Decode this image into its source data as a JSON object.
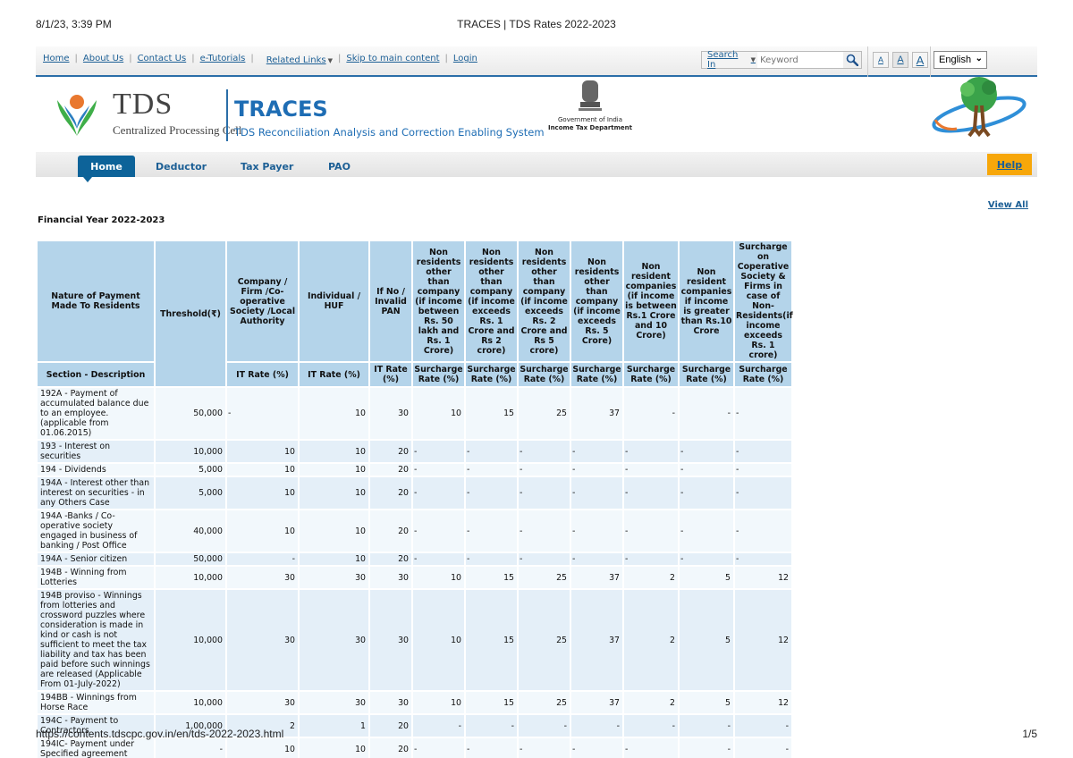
{
  "print": {
    "date": "8/1/23, 3:39 PM",
    "title": "TRACES | TDS Rates 2022-2023",
    "url": "https://contents.tdscpc.gov.in/en/tds-2022-2023.html",
    "page": "1/5"
  },
  "topbar": {
    "links": [
      "Home",
      "About Us",
      "Contact Us",
      "e-Tutorials"
    ],
    "related_links": "Related Links",
    "skip": "Skip to main content",
    "login": "Login",
    "search_in": "Search In",
    "search_placeholder": "Keyword",
    "font_sizes": [
      "A",
      "A",
      "A"
    ],
    "language": "English"
  },
  "banner": {
    "tds": "TDS",
    "cpc": "Centralized Processing Cell",
    "traces": "TRACES",
    "traces_sub": "TDS Reconciliation Analysis and Correction Enabling System",
    "gov": "Government of India",
    "itd": "Income Tax Department"
  },
  "nav": {
    "tabs": [
      "Home",
      "Deductor",
      "Tax Payer",
      "PAO"
    ],
    "active": "Home",
    "help": "Help"
  },
  "view_all": "View All",
  "fy_title": "Financial Year 2022-2023",
  "table": {
    "headers_top": [
      "Nature of Payment Made To Residents",
      "Threshold(₹)",
      "Company / Firm /Co-operative Society /Local Authority",
      "Individual / HUF",
      "If No / Invalid PAN",
      "Non residents other than company (if income between Rs. 50 lakh and Rs. 1 Crore)",
      "Non residents other than company (if income exceeds Rs. 1 Crore and Rs 2 crore)",
      "Non residents other than company (if income exceeds Rs. 2 Crore and Rs 5 crore)",
      "Non residents other than company (if income exceeds Rs. 5 Crore)",
      "Non resident companies (if income is between Rs.1 Crore and 10 Crore)",
      "Non resident companies if income is greater than Rs.10 Crore",
      "Surcharge on Coperative Society & Firms in case of Non-Residents(if income exceeds Rs. 1 crore)"
    ],
    "headers_sub": [
      "Section - Description",
      "IT Rate (%)",
      "IT Rate (%)",
      "IT Rate (%)",
      "Surcharge Rate (%)",
      "Surcharge Rate (%)",
      "Surcharge Rate (%)",
      "Surcharge Rate (%)",
      "Surcharge Rate (%)",
      "Surcharge Rate (%)",
      "Surcharge Rate (%)"
    ],
    "rows": [
      {
        "desc": "192A - Payment of accumulated balance due to an employee.(applicable from 01.06.2015)",
        "threshold": "50,000",
        "cells": [
          {
            "v": "-",
            "a": "l"
          },
          {
            "v": "10",
            "a": "r"
          },
          {
            "v": "30",
            "a": "r"
          },
          {
            "v": "10",
            "a": "r"
          },
          {
            "v": "15",
            "a": "r"
          },
          {
            "v": "25",
            "a": "r"
          },
          {
            "v": "37",
            "a": "r"
          },
          {
            "v": "-",
            "a": "r"
          },
          {
            "v": "-",
            "a": "r"
          },
          {
            "v": "-",
            "a": "l"
          }
        ]
      },
      {
        "desc": "193 - Interest on securities",
        "threshold": "10,000",
        "cells": [
          {
            "v": "10",
            "a": "r"
          },
          {
            "v": "10",
            "a": "r"
          },
          {
            "v": "20",
            "a": "r"
          },
          {
            "v": "-",
            "a": "l"
          },
          {
            "v": "-",
            "a": "l"
          },
          {
            "v": "-",
            "a": "l"
          },
          {
            "v": "-",
            "a": "l"
          },
          {
            "v": "-",
            "a": "l"
          },
          {
            "v": "-",
            "a": "l"
          },
          {
            "v": "-",
            "a": "l"
          }
        ]
      },
      {
        "desc": "194 - Dividends",
        "threshold": "5,000",
        "cells": [
          {
            "v": "10",
            "a": "r"
          },
          {
            "v": "10",
            "a": "r"
          },
          {
            "v": "20",
            "a": "r"
          },
          {
            "v": "-",
            "a": "l"
          },
          {
            "v": "-",
            "a": "l"
          },
          {
            "v": "-",
            "a": "l"
          },
          {
            "v": "-",
            "a": "l"
          },
          {
            "v": "-",
            "a": "l"
          },
          {
            "v": "-",
            "a": "l"
          },
          {
            "v": "-",
            "a": "l"
          }
        ]
      },
      {
        "desc": "194A - Interest other than interest on securities - in any Others Case",
        "threshold": "5,000",
        "cells": [
          {
            "v": "10",
            "a": "r"
          },
          {
            "v": "10",
            "a": "r"
          },
          {
            "v": "20",
            "a": "r"
          },
          {
            "v": "-",
            "a": "l"
          },
          {
            "v": "-",
            "a": "l"
          },
          {
            "v": "-",
            "a": "l"
          },
          {
            "v": "-",
            "a": "l"
          },
          {
            "v": "-",
            "a": "l"
          },
          {
            "v": "-",
            "a": "l"
          },
          {
            "v": "-",
            "a": "l"
          }
        ]
      },
      {
        "desc": "194A -Banks / Co-operative society engaged in business of banking / Post Office",
        "threshold": "40,000",
        "cells": [
          {
            "v": "10",
            "a": "r"
          },
          {
            "v": "10",
            "a": "r"
          },
          {
            "v": "20",
            "a": "r"
          },
          {
            "v": "-",
            "a": "l"
          },
          {
            "v": "-",
            "a": "l"
          },
          {
            "v": "-",
            "a": "l"
          },
          {
            "v": "-",
            "a": "l"
          },
          {
            "v": "-",
            "a": "l"
          },
          {
            "v": "-",
            "a": "l"
          },
          {
            "v": "-",
            "a": "l"
          }
        ]
      },
      {
        "desc": "194A - Senior citizen",
        "threshold": "50,000",
        "cells": [
          {
            "v": "-",
            "a": "r"
          },
          {
            "v": "10",
            "a": "r"
          },
          {
            "v": "20",
            "a": "r"
          },
          {
            "v": "-",
            "a": "l"
          },
          {
            "v": "-",
            "a": "l"
          },
          {
            "v": "-",
            "a": "l"
          },
          {
            "v": "-",
            "a": "l"
          },
          {
            "v": "-",
            "a": "l"
          },
          {
            "v": "-",
            "a": "l"
          },
          {
            "v": "-",
            "a": "l"
          }
        ]
      },
      {
        "desc": "194B - Winning from Lotteries",
        "threshold": "10,000",
        "cells": [
          {
            "v": "30",
            "a": "r"
          },
          {
            "v": "30",
            "a": "r"
          },
          {
            "v": "30",
            "a": "r"
          },
          {
            "v": "10",
            "a": "r"
          },
          {
            "v": "15",
            "a": "r"
          },
          {
            "v": "25",
            "a": "r"
          },
          {
            "v": "37",
            "a": "r"
          },
          {
            "v": "2",
            "a": "r"
          },
          {
            "v": "5",
            "a": "r"
          },
          {
            "v": "12",
            "a": "r"
          }
        ]
      },
      {
        "desc": "194B proviso - Winnings from lotteries and crossword puzzles where consideration is made in kind or cash is not sufficient to meet the tax liability and tax has been paid before such winnings are released (Applicable From 01-July-2022)",
        "threshold": "10,000",
        "cells": [
          {
            "v": "30",
            "a": "r"
          },
          {
            "v": "30",
            "a": "r"
          },
          {
            "v": "30",
            "a": "r"
          },
          {
            "v": "10",
            "a": "r"
          },
          {
            "v": "15",
            "a": "r"
          },
          {
            "v": "25",
            "a": "r"
          },
          {
            "v": "37",
            "a": "r"
          },
          {
            "v": "2",
            "a": "r"
          },
          {
            "v": "5",
            "a": "r"
          },
          {
            "v": "12",
            "a": "r"
          }
        ]
      },
      {
        "desc": "194BB - Winnings from Horse Race",
        "threshold": "10,000",
        "cells": [
          {
            "v": "30",
            "a": "r"
          },
          {
            "v": "30",
            "a": "r"
          },
          {
            "v": "30",
            "a": "r"
          },
          {
            "v": "10",
            "a": "r"
          },
          {
            "v": "15",
            "a": "r"
          },
          {
            "v": "25",
            "a": "r"
          },
          {
            "v": "37",
            "a": "r"
          },
          {
            "v": "2",
            "a": "r"
          },
          {
            "v": "5",
            "a": "r"
          },
          {
            "v": "12",
            "a": "r"
          }
        ]
      },
      {
        "desc": "194C - Payment to Contractors",
        "threshold": "1,00,000",
        "cells": [
          {
            "v": "2",
            "a": "r"
          },
          {
            "v": "1",
            "a": "r"
          },
          {
            "v": "20",
            "a": "r"
          },
          {
            "v": "-",
            "a": "r"
          },
          {
            "v": "-",
            "a": "r"
          },
          {
            "v": "-",
            "a": "r"
          },
          {
            "v": "-",
            "a": "r"
          },
          {
            "v": "-",
            "a": "r"
          },
          {
            "v": "-",
            "a": "r"
          },
          {
            "v": "-",
            "a": "r"
          }
        ]
      },
      {
        "desc": "194IC- Payment under Specified agreement",
        "threshold": "-",
        "cells": [
          {
            "v": "10",
            "a": "r"
          },
          {
            "v": "10",
            "a": "r"
          },
          {
            "v": "20",
            "a": "r"
          },
          {
            "v": "-",
            "a": "l"
          },
          {
            "v": "-",
            "a": "l"
          },
          {
            "v": "-",
            "a": "l"
          },
          {
            "v": "-",
            "a": "l"
          },
          {
            "v": "-",
            "a": "l"
          },
          {
            "v": "-",
            "a": "r"
          },
          {
            "v": "-",
            "a": "r"
          }
        ]
      }
    ]
  }
}
